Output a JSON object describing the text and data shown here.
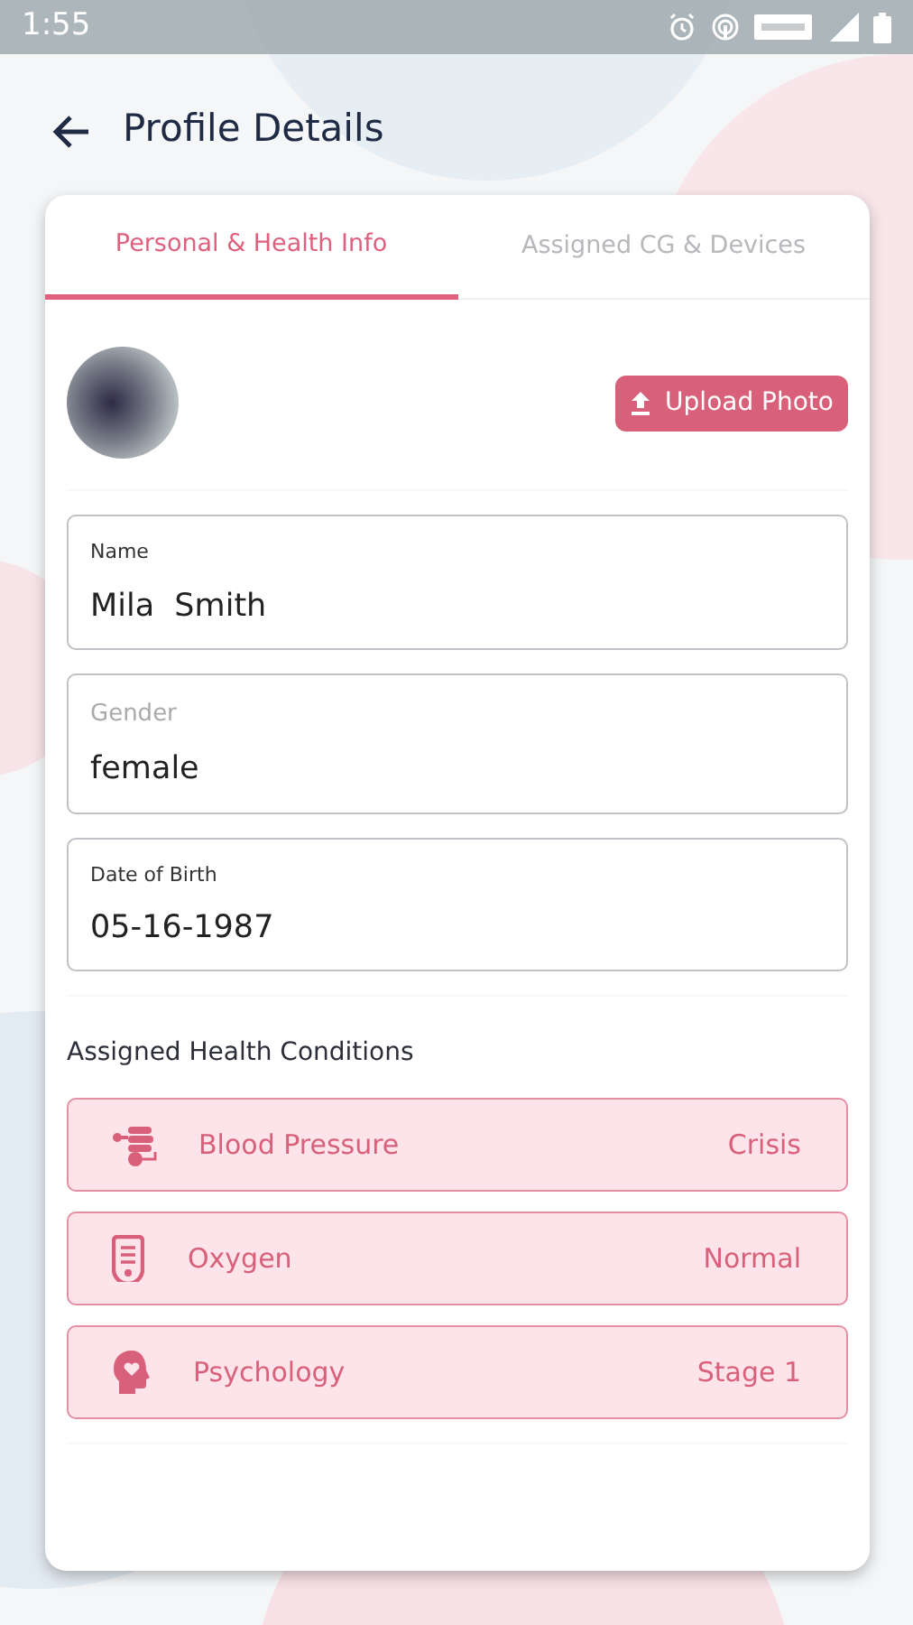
{
  "status_bar": {
    "time": "1:55"
  },
  "header": {
    "title": "Profile Details"
  },
  "tabs": [
    {
      "label": "Personal & Health Info",
      "selected": true
    },
    {
      "label": "Assigned CG & Devices",
      "selected": false
    }
  ],
  "upload_button": {
    "label": "Upload Photo"
  },
  "fields": [
    {
      "label": "Name",
      "value": "Mila  Smith",
      "kind": "text"
    },
    {
      "label": "Gender",
      "value": "female",
      "kind": "select"
    },
    {
      "label": "Date of Birth",
      "value": "05-16-1987",
      "kind": "text"
    }
  ],
  "conditions_title": "Assigned Health Conditions",
  "conditions": [
    {
      "name": "Blood Pressure",
      "status": "Crisis"
    },
    {
      "name": "Oxygen",
      "status": "Normal"
    },
    {
      "name": "Psychology",
      "status": "Stage 1"
    }
  ]
}
